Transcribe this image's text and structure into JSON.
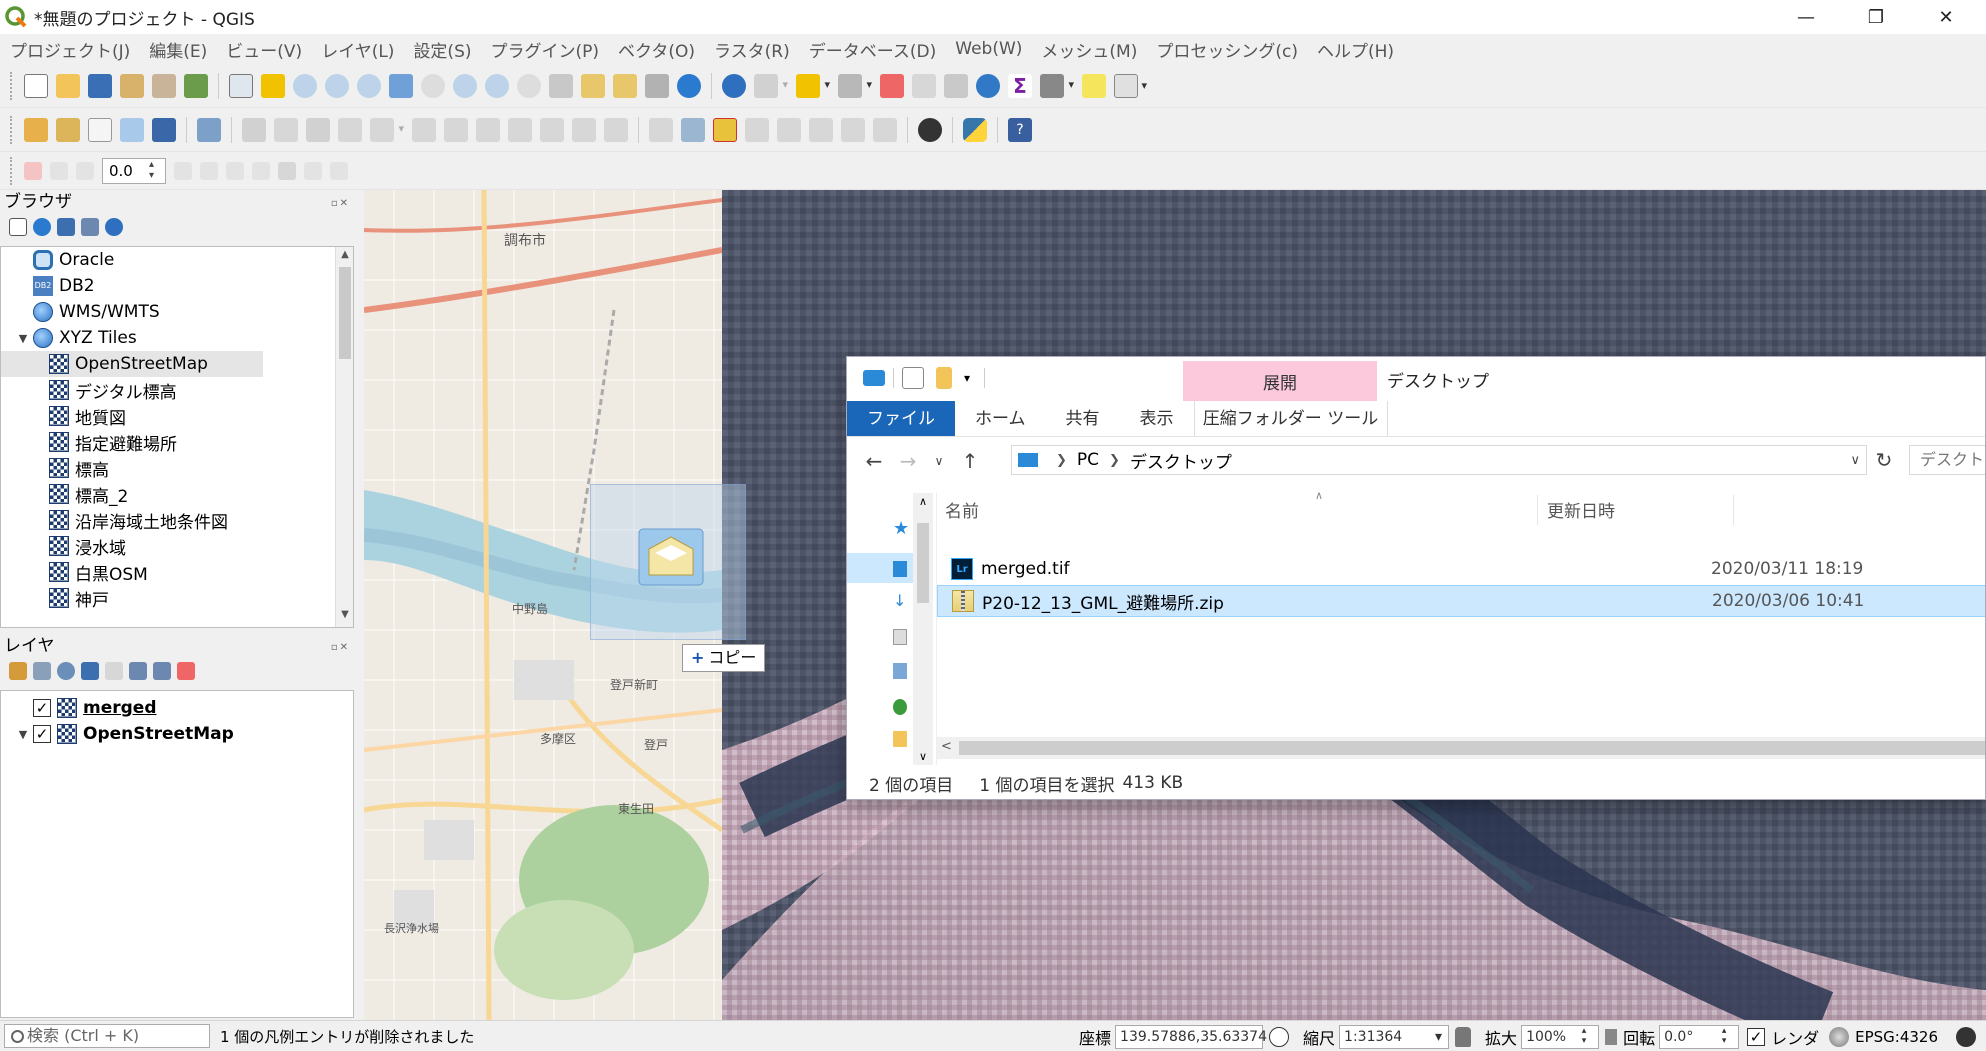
{
  "window": {
    "title": "*無題のプロジェクト - QGIS",
    "minimize": "—",
    "restore": "❐",
    "close": "✕"
  },
  "menu": [
    "プロジェクト(J)",
    "編集(E)",
    "ビュー(V)",
    "レイヤ(L)",
    "設定(S)",
    "プラグイン(P)",
    "ベクタ(O)",
    "ラスタ(R)",
    "データベース(D)",
    "Web(W)",
    "メッシュ(M)",
    "プロセッシング(c)",
    "ヘルプ(H)"
  ],
  "label_toolbar": {
    "value": "0.0"
  },
  "browser": {
    "title": "ブラウザ",
    "items": [
      {
        "label": "Oracle",
        "icon": "oracle-icon"
      },
      {
        "label": "DB2",
        "icon": "db2-icon"
      },
      {
        "label": "WMS/WMTS",
        "icon": "globe-icon"
      },
      {
        "label": "XYZ Tiles",
        "icon": "globe-icon",
        "expanded": true
      },
      {
        "label": "OpenStreetMap",
        "icon": "xyz-tile-icon",
        "selected": true
      },
      {
        "label": "デジタル標高",
        "icon": "xyz-tile-icon"
      },
      {
        "label": "地質図",
        "icon": "xyz-tile-icon"
      },
      {
        "label": "指定避難場所",
        "icon": "xyz-tile-icon"
      },
      {
        "label": "標高",
        "icon": "xyz-tile-icon"
      },
      {
        "label": "標高_2",
        "icon": "xyz-tile-icon"
      },
      {
        "label": "沿岸海域土地条件図",
        "icon": "xyz-tile-icon"
      },
      {
        "label": "浸水域",
        "icon": "xyz-tile-icon"
      },
      {
        "label": "白黒OSM",
        "icon": "xyz-tile-icon"
      },
      {
        "label": "神戸",
        "icon": "xyz-tile-icon"
      }
    ]
  },
  "layers": {
    "title": "レイヤ",
    "items": [
      {
        "label": "merged",
        "checked": true,
        "checkmark": "✓"
      },
      {
        "label": "OpenStreetMap",
        "checked": true,
        "checkmark": "✓"
      }
    ]
  },
  "map": {
    "labels": [
      "調布市",
      "多摩区",
      "登戸新町",
      "中野島",
      "東生田",
      "登戸",
      "長沢浄水場"
    ]
  },
  "drag": {
    "tooltip_plus": "+",
    "tooltip": "コピー"
  },
  "explorer": {
    "context_tab": "展開",
    "title": "デスクトップ",
    "ribbon_tabs": [
      "ファイル",
      "ホーム",
      "共有",
      "表示",
      "圧縮フォルダー ツール"
    ],
    "breadcrumb": [
      "PC",
      "デスクトップ"
    ],
    "search_placeholder": "デスクトップ",
    "columns": {
      "name": "名前",
      "date": "更新日時"
    },
    "files": [
      {
        "name": "merged.tif",
        "date": "2020/03/11 18:19",
        "icon": "lightroom-icon",
        "selected": false
      },
      {
        "name": "P20-12_13_GML_避難場所.zip",
        "date": "2020/03/06 10:41",
        "icon": "zip-folder-icon",
        "selected": true
      }
    ],
    "status": {
      "count": "2 個の項目",
      "selected": "1 個の項目を選択",
      "size": "413 KB"
    }
  },
  "statusbar": {
    "locator_placeholder": "検索 (Ctrl + K)",
    "message": "1 個の凡例エントリが削除されました",
    "coord_label": "座標",
    "coord_value": "139.57886,35.63374",
    "scale_label": "縮尺",
    "scale_value": "1:31364",
    "magnifier_label": "拡大",
    "magnifier_value": "100%",
    "rotation_label": "回転",
    "rotation_value": "0.0°",
    "render_label": "レンダ",
    "crs_label": "EPSG:4326"
  }
}
